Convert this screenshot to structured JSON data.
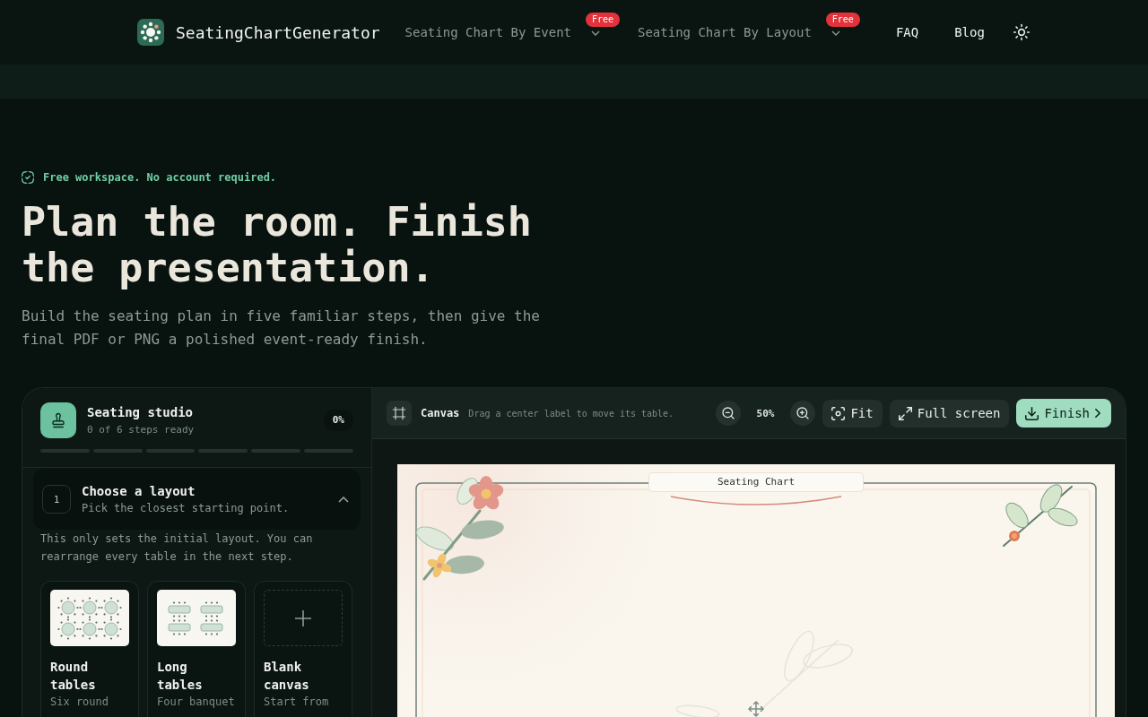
{
  "header": {
    "brand": "SeatingChartGenerator",
    "nav": [
      {
        "kind": "dropdown",
        "label": "Seating Chart By Event",
        "badge": "Free"
      },
      {
        "kind": "dropdown",
        "label": "Seating Chart By Layout",
        "badge": "Free"
      },
      {
        "kind": "link",
        "label": "FAQ"
      },
      {
        "kind": "link",
        "label": "Blog"
      }
    ]
  },
  "hero": {
    "eyebrow": "Free workspace. No account required.",
    "title": "Plan the room. Finish the presentation.",
    "description": "Build the seating plan in five familiar steps, then give the final PDF or PNG a polished event-ready finish."
  },
  "studio": {
    "title": "Seating studio",
    "status": "0 of 6 steps ready",
    "percent": "0%",
    "segments": [
      {
        "complete": false
      },
      {
        "complete": false
      },
      {
        "complete": false
      },
      {
        "complete": false
      },
      {
        "complete": false
      },
      {
        "complete": false
      }
    ],
    "step": {
      "number": "1",
      "title": "Choose a layout",
      "subtitle": "Pick the closest starting point.",
      "expanded": true,
      "note": "This only sets the initial layout. You can rearrange every table in the next step.",
      "layouts": [
        {
          "kind": "round",
          "title": "Round tables",
          "description": "Six round",
          "selected": false
        },
        {
          "kind": "long",
          "title": "Long tables",
          "description": "Four banquet",
          "selected": false
        },
        {
          "kind": "blank",
          "title": "Blank canvas",
          "description": "Start from",
          "selected": false
        }
      ]
    }
  },
  "canvas": {
    "label": "Canvas",
    "hint": "Drag a center label to move its table.",
    "zoom": "50%",
    "buttons": [
      {
        "kind": "fit",
        "label": "Fit"
      },
      {
        "kind": "fullscreen",
        "label": "Full screen"
      },
      {
        "kind": "finish",
        "label": "Finish"
      }
    ],
    "chart_title": "Seating Chart"
  }
}
